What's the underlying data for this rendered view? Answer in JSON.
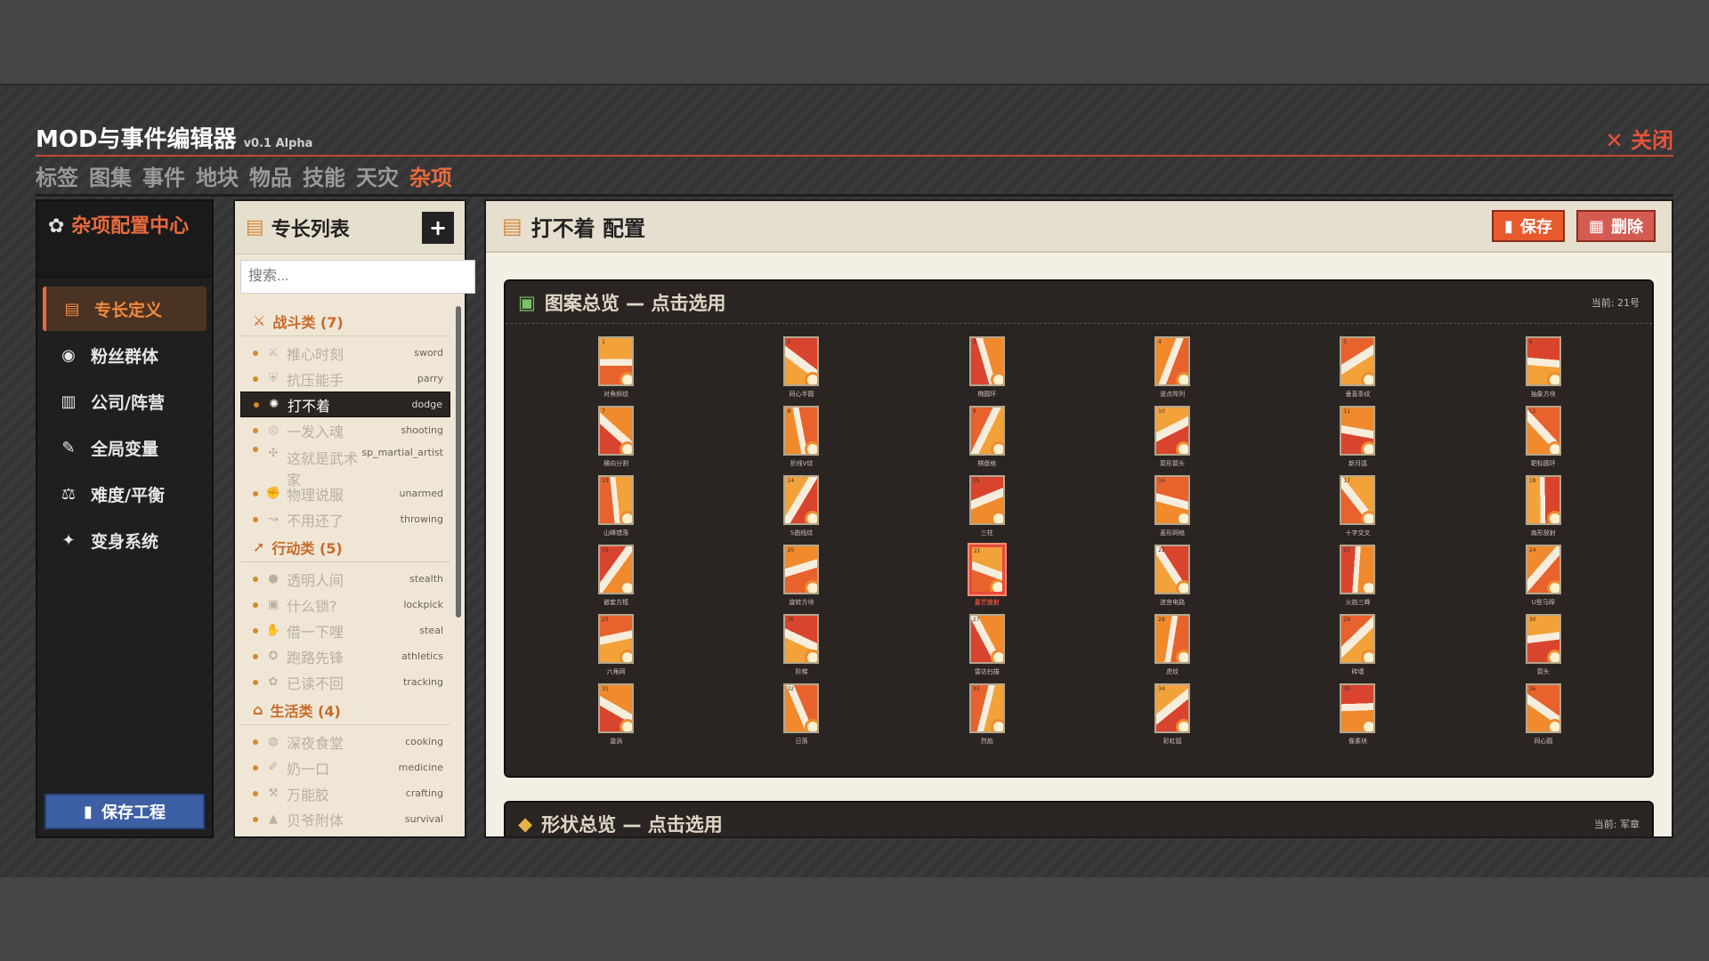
{
  "app": {
    "title": "MOD与事件编辑器",
    "version": "v0.1 Alpha",
    "close_label": "✕ 关闭"
  },
  "nav": [
    "标签",
    "图集",
    "事件",
    "地块",
    "物品",
    "技能",
    "天灾",
    "杂项"
  ],
  "nav_active": 7,
  "sidebar": {
    "header": "杂项配置中心",
    "header_icon": "gear-icon",
    "items": [
      {
        "label": "专长定义",
        "icon": "scroll-icon",
        "active": true
      },
      {
        "label": "粉丝群体",
        "icon": "eye-icon"
      },
      {
        "label": "公司/阵营",
        "icon": "building-icon"
      },
      {
        "label": "全局变量",
        "icon": "wrench-icon"
      },
      {
        "label": "难度/平衡",
        "icon": "scale-icon"
      },
      {
        "label": "变身系统",
        "icon": "sparkle-icon"
      }
    ],
    "save_project_label": "保存工程"
  },
  "perk_list": {
    "title": "专长列表",
    "add_label": "+",
    "search_placeholder": "搜索...",
    "categories": [
      {
        "label": "战斗类 (7)",
        "icon": "swords-icon",
        "items": [
          {
            "name": "推心时刻",
            "id": "sword",
            "icon": "swords-icon"
          },
          {
            "name": "抗压能手",
            "id": "parry",
            "icon": "shield-icon"
          },
          {
            "name": "打不着",
            "id": "dodge",
            "icon": "dodge-icon",
            "selected": true
          },
          {
            "name": "一发入魂",
            "id": "shooting",
            "icon": "target-icon"
          },
          {
            "name": "这就是武术家",
            "id": "sp_martial_artist",
            "icon": "martial-icon"
          },
          {
            "name": "物理说服",
            "id": "unarmed",
            "icon": "fist-icon"
          },
          {
            "name": "不用还了",
            "id": "throwing",
            "icon": "boomerang-icon"
          }
        ]
      },
      {
        "label": "行动类 (5)",
        "icon": "run-icon",
        "items": [
          {
            "name": "透明人间",
            "id": "stealth",
            "icon": "orb-icon"
          },
          {
            "name": "什么锁?",
            "id": "lockpick",
            "icon": "lock-icon"
          },
          {
            "name": "借一下哩",
            "id": "steal",
            "icon": "hand-icon"
          },
          {
            "name": "跑路先锋",
            "id": "athletics",
            "icon": "runner-icon"
          },
          {
            "name": "已读不回",
            "id": "tracking",
            "icon": "paw-icon"
          }
        ]
      },
      {
        "label": "生活类 (4)",
        "icon": "house-icon",
        "items": [
          {
            "name": "深夜食堂",
            "id": "cooking",
            "icon": "pan-icon"
          },
          {
            "name": "奶一口",
            "id": "medicine",
            "icon": "syringe-icon"
          },
          {
            "name": "万能胶",
            "id": "crafting",
            "icon": "tool-icon"
          },
          {
            "name": "贝爷附体",
            "id": "survival",
            "icon": "camp-icon"
          }
        ]
      }
    ]
  },
  "config": {
    "title": "打不着 配置",
    "save_label": "保存",
    "delete_label": "删除",
    "pattern_panel": {
      "title": "图案总览 — 点击选用",
      "current": "当前: 21号",
      "selected": 21,
      "patterns": [
        {
          "n": 1,
          "name": "对角斜纹"
        },
        {
          "n": 2,
          "name": "同心半圆"
        },
        {
          "n": 3,
          "name": "椭圆环"
        },
        {
          "n": 4,
          "name": "波点阵列"
        },
        {
          "n": 5,
          "name": "垂直条纹"
        },
        {
          "n": 6,
          "name": "抽象方块"
        },
        {
          "n": 7,
          "name": "横向分割"
        },
        {
          "n": 8,
          "name": "折线V纹"
        },
        {
          "n": 9,
          "name": "棋盘格"
        },
        {
          "n": 10,
          "name": "箭形箭头"
        },
        {
          "n": 11,
          "name": "新月弧"
        },
        {
          "n": 12,
          "name": "靶标圆环"
        },
        {
          "n": 13,
          "name": "山峰错落"
        },
        {
          "n": 14,
          "name": "S曲线纹"
        },
        {
          "n": 15,
          "name": "三柱"
        },
        {
          "n": 16,
          "name": "菱形网格"
        },
        {
          "n": 17,
          "name": "十字交叉"
        },
        {
          "n": 18,
          "name": "扇形放射"
        },
        {
          "n": 19,
          "name": "嵌套方框"
        },
        {
          "n": 20,
          "name": "旋转方块"
        },
        {
          "n": 21,
          "name": "星芒放射"
        },
        {
          "n": 22,
          "name": "迷宫电路"
        },
        {
          "n": 23,
          "name": "火焰三峰"
        },
        {
          "n": 24,
          "name": "U型马蹄"
        },
        {
          "n": 25,
          "name": "六角网"
        },
        {
          "n": 26,
          "name": "阶梯"
        },
        {
          "n": 27,
          "name": "雷达扫描"
        },
        {
          "n": 28,
          "name": "虎纹"
        },
        {
          "n": 29,
          "name": "砖墙"
        },
        {
          "n": 30,
          "name": "箭头"
        },
        {
          "n": 31,
          "name": "漩涡"
        },
        {
          "n": 32,
          "name": "日落"
        },
        {
          "n": 33,
          "name": "烈焰"
        },
        {
          "n": 34,
          "name": "彩虹弧"
        },
        {
          "n": 35,
          "name": "像素块"
        },
        {
          "n": 36,
          "name": "同心圆"
        }
      ]
    },
    "shape_panel": {
      "title": "形状总览 — 点击选用",
      "current": "当前: 军章"
    }
  },
  "colors": {
    "accent": "#e96a3d",
    "panel": "#2a2523",
    "selected_border": "#e74a3a"
  }
}
